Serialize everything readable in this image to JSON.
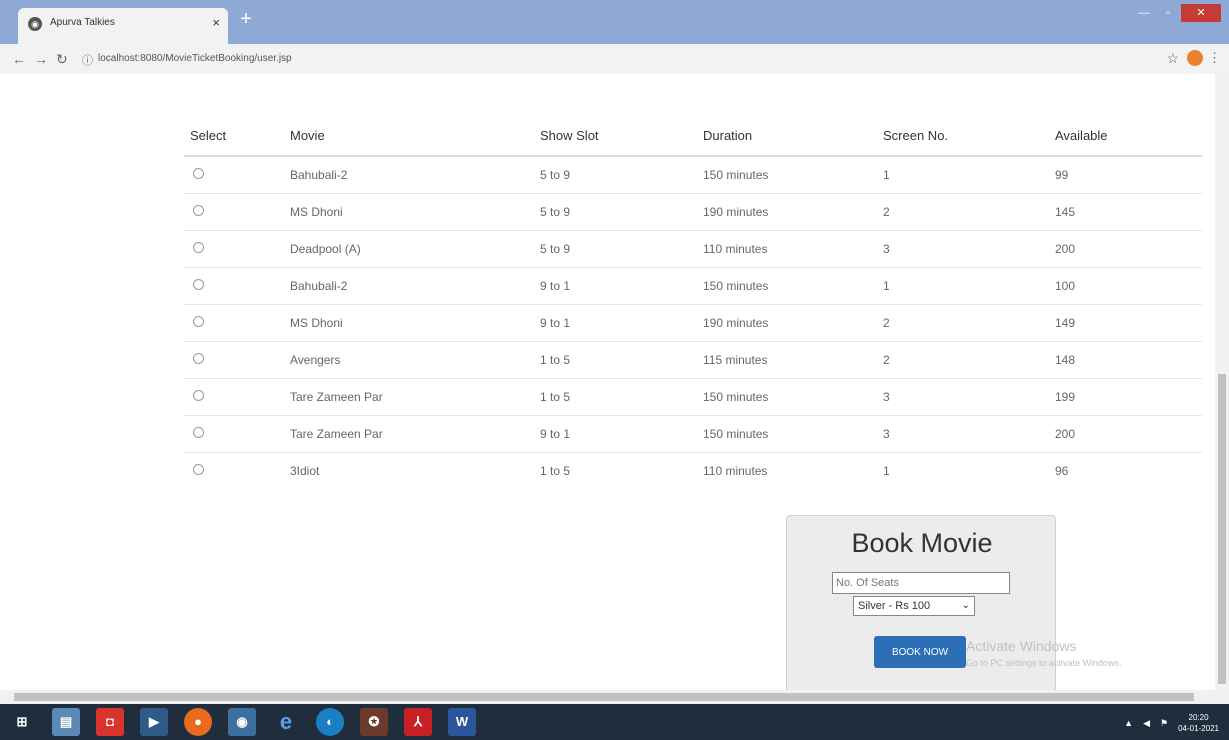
{
  "browser": {
    "tab_title": "Apurva Talkies",
    "tab_close": "×",
    "new_tab": "+",
    "url": "localhost:8080/MovieTicketBooking/user.jsp"
  },
  "table": {
    "headers": [
      "Select",
      "Movie",
      "Show Slot",
      "Duration",
      "Screen No.",
      "Available"
    ],
    "rows": [
      {
        "movie": "Bahubali-2",
        "slot": "5 to 9",
        "duration": "150 minutes",
        "screen": "1",
        "available": "99"
      },
      {
        "movie": "MS Dhoni",
        "slot": "5 to 9",
        "duration": "190 minutes",
        "screen": "2",
        "available": "145"
      },
      {
        "movie": "Deadpool (A)",
        "slot": "5 to 9",
        "duration": "110 minutes",
        "screen": "3",
        "available": "200"
      },
      {
        "movie": "Bahubali-2",
        "slot": "9 to 1",
        "duration": "150 minutes",
        "screen": "1",
        "available": "100"
      },
      {
        "movie": "MS Dhoni",
        "slot": "9 to 1",
        "duration": "190 minutes",
        "screen": "2",
        "available": "149"
      },
      {
        "movie": "Avengers",
        "slot": "1 to 5",
        "duration": "115 minutes",
        "screen": "2",
        "available": "148"
      },
      {
        "movie": "Tare Zameen Par",
        "slot": "1 to 5",
        "duration": "150 minutes",
        "screen": "3",
        "available": "199"
      },
      {
        "movie": "Tare Zameen Par",
        "slot": "9 to 1",
        "duration": "150 minutes",
        "screen": "3",
        "available": "200"
      },
      {
        "movie": "3Idiot",
        "slot": "1 to 5",
        "duration": "110 minutes",
        "screen": "1",
        "available": "96"
      }
    ]
  },
  "booking": {
    "title": "Book Movie",
    "seats_placeholder": "No. Of Seats",
    "class_selected": "Silver - Rs 100",
    "button_label": "BOOK NOW"
  },
  "watermark": {
    "line1": "Activate Windows",
    "line2": "Go to PC settings to activate Windows."
  },
  "taskbar": {
    "time": "20:20",
    "date": "04-01-2021"
  },
  "colors": {
    "titlebar": "#8fa9d6",
    "button": "#2d6fb7",
    "taskbar": "#1f2d3d"
  }
}
